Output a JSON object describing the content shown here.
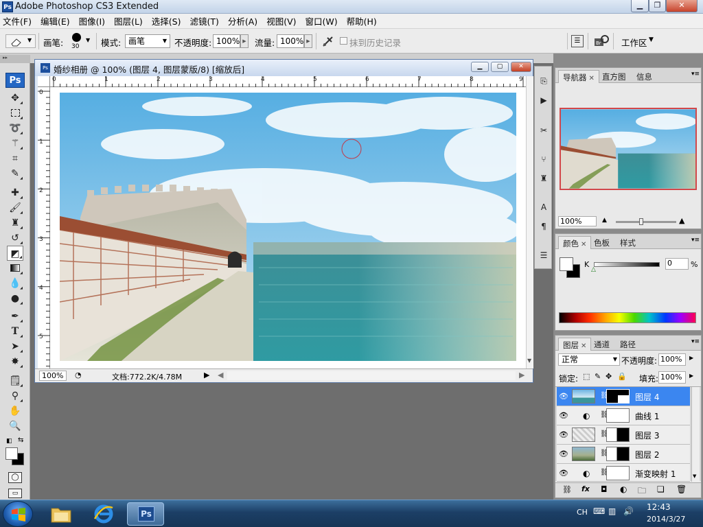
{
  "window": {
    "title": "Adobe Photoshop CS3 Extended",
    "app_icon": "Ps",
    "minimize_icon": "minimize-icon",
    "maximize_icon": "restore-icon",
    "close_icon": "close-icon"
  },
  "menu": [
    "文件(F)",
    "编辑(E)",
    "图像(I)",
    "图层(L)",
    "选择(S)",
    "滤镜(T)",
    "分析(A)",
    "视图(V)",
    "窗口(W)",
    "帮助(H)"
  ],
  "options_bar": {
    "brush_label": "画笔:",
    "brush_size": "30",
    "mode_label": "模式:",
    "mode_value": "画笔",
    "opacity_label": "不透明度:",
    "opacity_value": "100%",
    "flow_label": "流量:",
    "flow_value": "100%",
    "erase_history_label": "抹到历史记录",
    "workspace_label": "工作区"
  },
  "toolbox": {
    "logo": "Ps",
    "tools": [
      "move-icon",
      "marquee-icon",
      "lasso-icon",
      "magic-wand-icon",
      "crop-icon",
      "slice-icon",
      "healing-brush-icon",
      "brush-icon",
      "clone-stamp-icon",
      "history-brush-icon",
      "eraser-icon",
      "gradient-icon",
      "blur-icon",
      "dodge-icon",
      "pen-icon",
      "type-icon",
      "path-selection-icon",
      "shape-icon",
      "notes-icon",
      "eyedropper-icon",
      "hand-icon",
      "zoom-icon"
    ]
  },
  "document": {
    "title": "婚纱相册 @ 100% (图层 4, 图层蒙版/8) [缩放后]",
    "h_ruler": [
      "0",
      "1",
      "2",
      "3",
      "4",
      "5",
      "6",
      "7",
      "8",
      "9"
    ],
    "v_ruler": [
      "0",
      "1",
      "2",
      "3",
      "4",
      "5"
    ],
    "zoom": "100%",
    "doc_size": "文档:772.2K/4.78M"
  },
  "navigator": {
    "tabs": [
      "导航器",
      "直方图",
      "信息"
    ],
    "zoom": "100%"
  },
  "color_panel": {
    "tabs": [
      "颜色",
      "色板",
      "样式"
    ],
    "channel_label": "K",
    "channel_value": "0",
    "unit": "%",
    "slider_percent": 0
  },
  "layers_panel": {
    "tabs": [
      "图层",
      "通道",
      "路径"
    ],
    "blend_mode": "正常",
    "opacity_label": "不透明度:",
    "opacity_value": "100%",
    "lock_label": "锁定:",
    "fill_label": "填充:",
    "fill_value": "100%",
    "layers": [
      {
        "name": "图层 4",
        "selected": true
      },
      {
        "name": "曲线 1",
        "selected": false
      },
      {
        "name": "图层 3",
        "selected": false
      },
      {
        "name": "图层 2",
        "selected": false
      },
      {
        "name": "渐变映射 1",
        "selected": false
      }
    ]
  },
  "taskbar": {
    "ime": "CH",
    "time": "12:43",
    "date": "2014/3/27"
  },
  "colors": {
    "selected_layer": "#3b86f0",
    "title_bar": "#c8d8ee",
    "taskbar": "#1c3f66"
  }
}
